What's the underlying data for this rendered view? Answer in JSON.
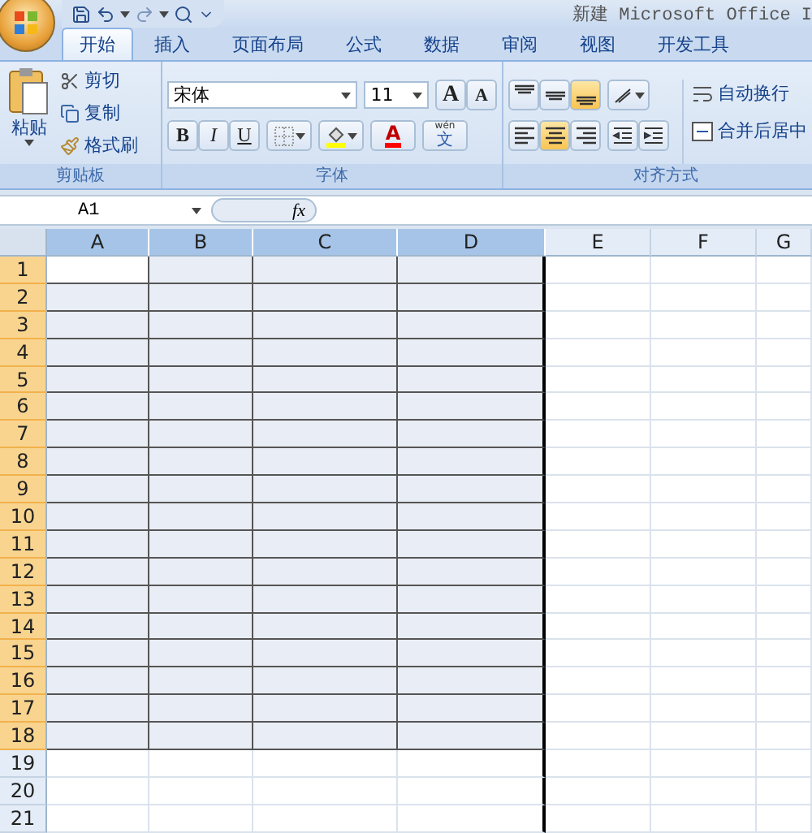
{
  "window": {
    "title": "新建 Microsoft Office I"
  },
  "tabs": [
    {
      "label": "开始",
      "selected": true
    },
    {
      "label": "插入",
      "selected": false
    },
    {
      "label": "页面布局",
      "selected": false
    },
    {
      "label": "公式",
      "selected": false
    },
    {
      "label": "数据",
      "selected": false
    },
    {
      "label": "审阅",
      "selected": false
    },
    {
      "label": "视图",
      "selected": false
    },
    {
      "label": "开发工具",
      "selected": false
    }
  ],
  "clipboard": {
    "paste": "粘贴",
    "items": [
      "剪切",
      "复制",
      "格式刷"
    ],
    "label": "剪贴板"
  },
  "font": {
    "name": "宋体",
    "size": "11",
    "grow": "A",
    "shrink": "A",
    "bold": "B",
    "italic": "I",
    "underline": "U",
    "font_color": "A",
    "phonetic_top": "wén",
    "phonetic_main": "文",
    "label": "字体"
  },
  "alignment": {
    "vertical": [
      {
        "kind": "top",
        "selected": false
      },
      {
        "kind": "middle",
        "selected": false
      },
      {
        "kind": "bottom",
        "selected": true
      }
    ],
    "horizontal": [
      {
        "kind": "left",
        "selected": false
      },
      {
        "kind": "center",
        "selected": true
      },
      {
        "kind": "right",
        "selected": false
      }
    ],
    "wrap": "自动换行",
    "merge": "合并后居中",
    "label": "对齐方式"
  },
  "formula_bar": {
    "name_box": "A1",
    "fx": "fx"
  },
  "columns": [
    {
      "label": "A",
      "selected": true
    },
    {
      "label": "B",
      "selected": true
    },
    {
      "label": "C",
      "selected": true
    },
    {
      "label": "D",
      "selected": true
    },
    {
      "label": "E",
      "selected": false
    },
    {
      "label": "F",
      "selected": false
    },
    {
      "label": "G",
      "selected": false
    }
  ],
  "rows": [
    {
      "label": "1",
      "selected": true
    },
    {
      "label": "2",
      "selected": true
    },
    {
      "label": "3",
      "selected": true
    },
    {
      "label": "4",
      "selected": true
    },
    {
      "label": "5",
      "selected": true
    },
    {
      "label": "6",
      "selected": true
    },
    {
      "label": "7",
      "selected": true
    },
    {
      "label": "8",
      "selected": true
    },
    {
      "label": "9",
      "selected": true
    },
    {
      "label": "10",
      "selected": true
    },
    {
      "label": "11",
      "selected": true
    },
    {
      "label": "12",
      "selected": true
    },
    {
      "label": "13",
      "selected": true
    },
    {
      "label": "14",
      "selected": true
    },
    {
      "label": "15",
      "selected": true
    },
    {
      "label": "16",
      "selected": true
    },
    {
      "label": "17",
      "selected": true
    },
    {
      "label": "18",
      "selected": true
    },
    {
      "label": "19",
      "selected": false
    },
    {
      "label": "20",
      "selected": false
    },
    {
      "label": "21",
      "selected": false
    }
  ]
}
